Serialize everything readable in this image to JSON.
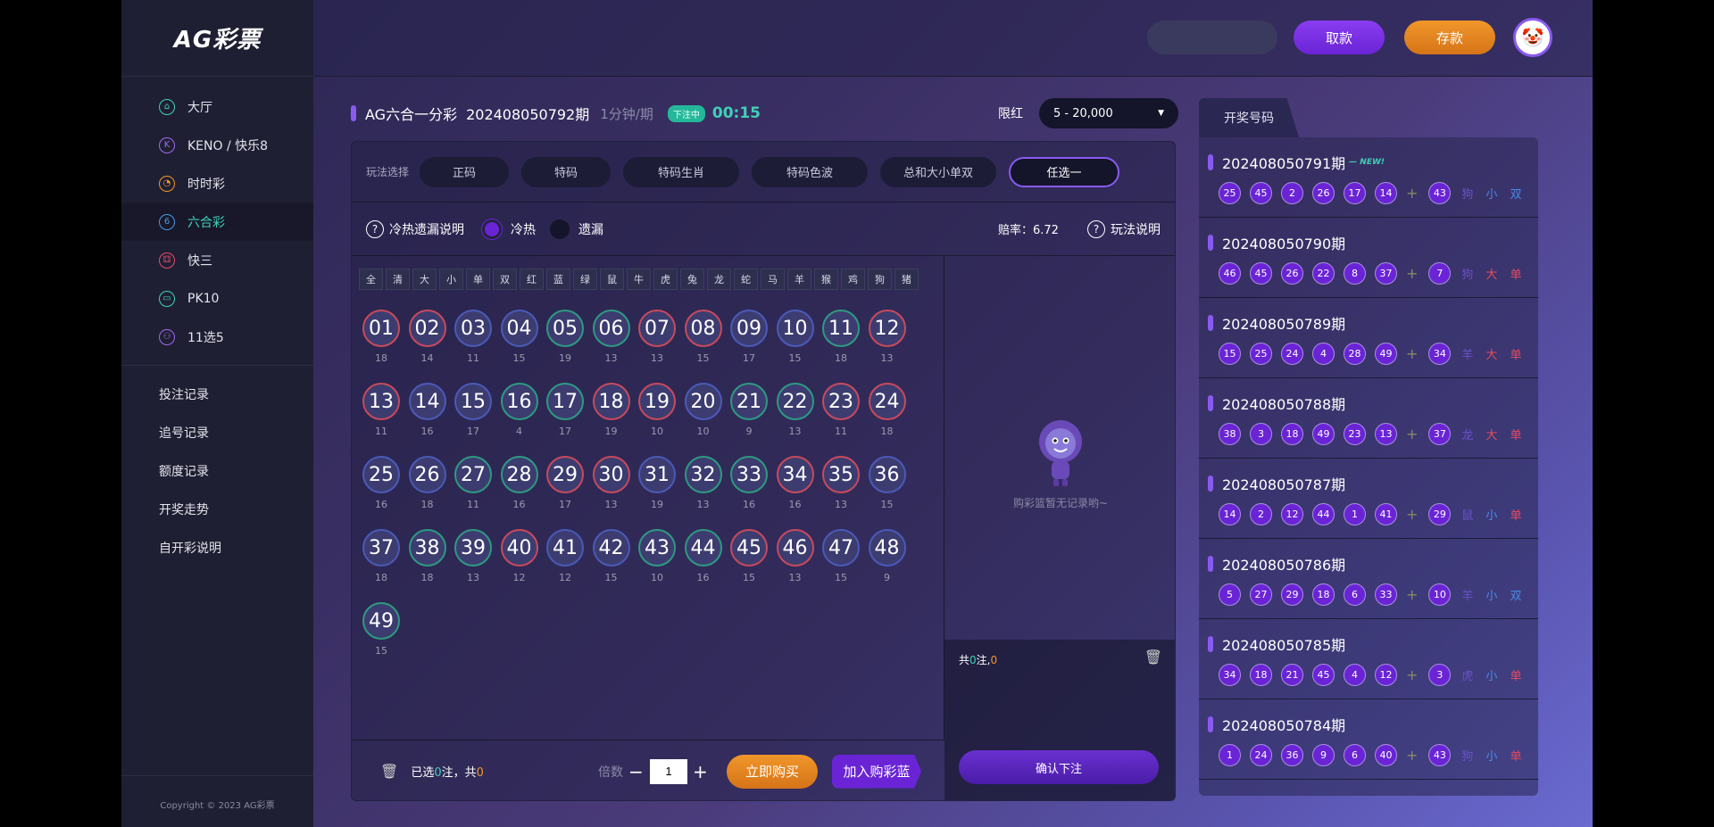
{
  "sidebar": {
    "logo": "AG彩票",
    "nav": [
      {
        "label": "大厅",
        "icon": "home-icon",
        "glyph": "⌂",
        "color": "#3fd1b7"
      },
      {
        "label": "KENO / 快乐8",
        "icon": "keno-icon",
        "glyph": "K",
        "color": "#a06af0"
      },
      {
        "label": "时时彩",
        "icon": "timer-icon",
        "glyph": "◔",
        "color": "#f0962a"
      },
      {
        "label": "六合彩",
        "icon": "six-icon",
        "glyph": "6",
        "color": "#4a9ae8",
        "active": true
      },
      {
        "label": "快三",
        "icon": "dice-icon",
        "glyph": "⚃",
        "color": "#e84a6a"
      },
      {
        "label": "PK10",
        "icon": "car-icon",
        "glyph": "▭",
        "color": "#3fd1b7"
      },
      {
        "label": "11选5",
        "icon": "group-icon",
        "glyph": "⚇",
        "color": "#a06af0"
      }
    ],
    "records": [
      "投注记录",
      "追号记录",
      "额度记录",
      "开奖走势",
      "自开彩说明"
    ],
    "copyright": "Copyright © 2023 AG彩票"
  },
  "topbar": {
    "withdraw": "取款",
    "deposit": "存款"
  },
  "game": {
    "name": "AG六合一分彩",
    "issue": "202408050792期",
    "period": "1分钟/期",
    "badge": "下注中",
    "timer": "00:15",
    "limit_label": "限红",
    "limit_value": "5 - 20,000"
  },
  "tabs": {
    "label": "玩法选择",
    "items": [
      "正码",
      "特码",
      "特码生肖",
      "特码色波",
      "总和大小单双",
      "任选一"
    ],
    "active_index": 5
  },
  "options": {
    "hot_cold_help": "冷热遗漏说明",
    "hot_cold": "冷热",
    "missing": "遗漏",
    "odds": "赔率：6.72",
    "rules": "玩法说明"
  },
  "quick_select": [
    "全",
    "清",
    "大",
    "小",
    "单",
    "双",
    "红",
    "蓝",
    "绿",
    "鼠",
    "牛",
    "虎",
    "兔",
    "龙",
    "蛇",
    "马",
    "羊",
    "猴",
    "鸡",
    "狗",
    "猪"
  ],
  "balls": [
    {
      "n": "01",
      "c": "red",
      "s": "18"
    },
    {
      "n": "02",
      "c": "red",
      "s": "14"
    },
    {
      "n": "03",
      "c": "blue",
      "s": "11"
    },
    {
      "n": "04",
      "c": "blue",
      "s": "15"
    },
    {
      "n": "05",
      "c": "green",
      "s": "19"
    },
    {
      "n": "06",
      "c": "green",
      "s": "13"
    },
    {
      "n": "07",
      "c": "red",
      "s": "13"
    },
    {
      "n": "08",
      "c": "red",
      "s": "15"
    },
    {
      "n": "09",
      "c": "blue",
      "s": "17"
    },
    {
      "n": "10",
      "c": "blue",
      "s": "15"
    },
    {
      "n": "11",
      "c": "green",
      "s": "18"
    },
    {
      "n": "12",
      "c": "red",
      "s": "13"
    },
    {
      "n": "13",
      "c": "red",
      "s": "11"
    },
    {
      "n": "14",
      "c": "blue",
      "s": "16"
    },
    {
      "n": "15",
      "c": "blue",
      "s": "17"
    },
    {
      "n": "16",
      "c": "green",
      "s": "4"
    },
    {
      "n": "17",
      "c": "green",
      "s": "17"
    },
    {
      "n": "18",
      "c": "red",
      "s": "19"
    },
    {
      "n": "19",
      "c": "red",
      "s": "10"
    },
    {
      "n": "20",
      "c": "blue",
      "s": "10"
    },
    {
      "n": "21",
      "c": "green",
      "s": "9"
    },
    {
      "n": "22",
      "c": "green",
      "s": "13"
    },
    {
      "n": "23",
      "c": "red",
      "s": "11"
    },
    {
      "n": "24",
      "c": "red",
      "s": "18"
    },
    {
      "n": "25",
      "c": "blue",
      "s": "16"
    },
    {
      "n": "26",
      "c": "blue",
      "s": "18"
    },
    {
      "n": "27",
      "c": "green",
      "s": "11"
    },
    {
      "n": "28",
      "c": "green",
      "s": "16"
    },
    {
      "n": "29",
      "c": "red",
      "s": "17"
    },
    {
      "n": "30",
      "c": "red",
      "s": "13"
    },
    {
      "n": "31",
      "c": "blue",
      "s": "19"
    },
    {
      "n": "32",
      "c": "green",
      "s": "13"
    },
    {
      "n": "33",
      "c": "green",
      "s": "16"
    },
    {
      "n": "34",
      "c": "red",
      "s": "16"
    },
    {
      "n": "35",
      "c": "red",
      "s": "13"
    },
    {
      "n": "36",
      "c": "blue",
      "s": "15"
    },
    {
      "n": "37",
      "c": "blue",
      "s": "18"
    },
    {
      "n": "38",
      "c": "green",
      "s": "18"
    },
    {
      "n": "39",
      "c": "green",
      "s": "13"
    },
    {
      "n": "40",
      "c": "red",
      "s": "12"
    },
    {
      "n": "41",
      "c": "blue",
      "s": "12"
    },
    {
      "n": "42",
      "c": "blue",
      "s": "15"
    },
    {
      "n": "43",
      "c": "green",
      "s": "10"
    },
    {
      "n": "44",
      "c": "green",
      "s": "16"
    },
    {
      "n": "45",
      "c": "red",
      "s": "15"
    },
    {
      "n": "46",
      "c": "red",
      "s": "13"
    },
    {
      "n": "47",
      "c": "blue",
      "s": "15"
    },
    {
      "n": "48",
      "c": "blue",
      "s": "9"
    },
    {
      "n": "49",
      "c": "green",
      "s": "15"
    }
  ],
  "cart": {
    "empty_text": "购彩篮暂无记录哟~",
    "sum_prefix": "共",
    "sum_count": "0",
    "sum_mid": "注,",
    "sum_amount": "0",
    "confirm": "确认下注"
  },
  "bottom": {
    "sel_prefix": "已选",
    "sel_count": "0",
    "sel_mid": "注，共",
    "sel_amount": "0",
    "mult_label": "倍数",
    "mult_value": "1",
    "buy_now": "立即购买",
    "add_cart": "加入购彩蓝"
  },
  "results": {
    "tab": "开奖号码",
    "new_label": "— NEW!",
    "items": [
      {
        "issue": "202408050791期",
        "new": true,
        "nums": [
          "25",
          "45",
          "2",
          "26",
          "17",
          "14"
        ],
        "special": "43",
        "tags": [
          {
            "t": "狗",
            "c": "zod"
          },
          {
            "t": "小",
            "c": "small"
          },
          {
            "t": "双",
            "c": "shuang"
          }
        ]
      },
      {
        "issue": "202408050790期",
        "nums": [
          "46",
          "45",
          "26",
          "22",
          "8",
          "37"
        ],
        "special": "7",
        "tags": [
          {
            "t": "狗",
            "c": "zod"
          },
          {
            "t": "大",
            "c": "big"
          },
          {
            "t": "单",
            "c": "dan"
          }
        ]
      },
      {
        "issue": "202408050789期",
        "nums": [
          "15",
          "25",
          "24",
          "4",
          "28",
          "49"
        ],
        "special": "34",
        "tags": [
          {
            "t": "羊",
            "c": "zod"
          },
          {
            "t": "大",
            "c": "big"
          },
          {
            "t": "单",
            "c": "dan"
          }
        ]
      },
      {
        "issue": "202408050788期",
        "nums": [
          "38",
          "3",
          "18",
          "49",
          "23",
          "13"
        ],
        "special": "37",
        "tags": [
          {
            "t": "龙",
            "c": "zod"
          },
          {
            "t": "大",
            "c": "big"
          },
          {
            "t": "单",
            "c": "dan"
          }
        ]
      },
      {
        "issue": "202408050787期",
        "nums": [
          "14",
          "2",
          "12",
          "44",
          "1",
          "41"
        ],
        "special": "29",
        "tags": [
          {
            "t": "鼠",
            "c": "zod"
          },
          {
            "t": "小",
            "c": "small"
          },
          {
            "t": "单",
            "c": "dan"
          }
        ]
      },
      {
        "issue": "202408050786期",
        "nums": [
          "5",
          "27",
          "29",
          "18",
          "6",
          "33"
        ],
        "special": "10",
        "tags": [
          {
            "t": "羊",
            "c": "zod"
          },
          {
            "t": "小",
            "c": "small"
          },
          {
            "t": "双",
            "c": "shuang"
          }
        ]
      },
      {
        "issue": "202408050785期",
        "nums": [
          "34",
          "18",
          "21",
          "45",
          "4",
          "12"
        ],
        "special": "3",
        "tags": [
          {
            "t": "虎",
            "c": "zod"
          },
          {
            "t": "小",
            "c": "small"
          },
          {
            "t": "单",
            "c": "dan"
          }
        ]
      },
      {
        "issue": "202408050784期",
        "nums": [
          "1",
          "24",
          "36",
          "9",
          "6",
          "40"
        ],
        "special": "43",
        "tags": [
          {
            "t": "狗",
            "c": "zod"
          },
          {
            "t": "小",
            "c": "small"
          },
          {
            "t": "单",
            "c": "dan"
          }
        ]
      }
    ]
  }
}
